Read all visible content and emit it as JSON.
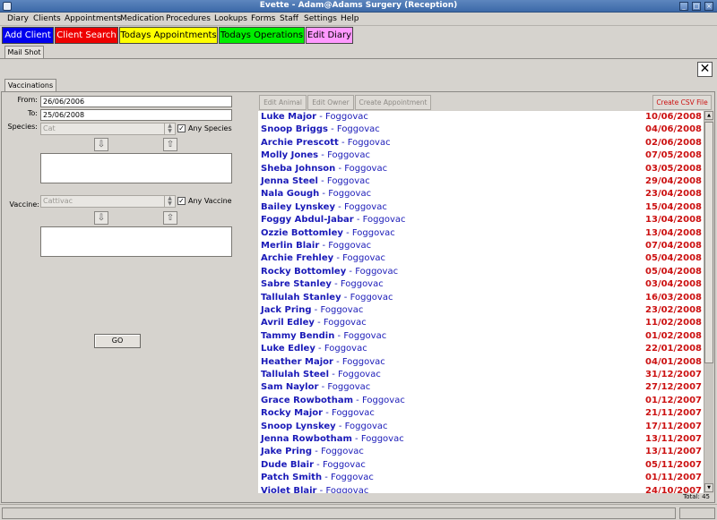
{
  "window": {
    "title": "Evette - Adam@Adams Surgery (Reception)"
  },
  "menu": [
    "Diary",
    "Clients",
    "Appointments",
    "Medication",
    "Procedures",
    "Lookups",
    "Forms",
    "Staff",
    "Settings",
    "Help"
  ],
  "quick_buttons": [
    {
      "label": "Add Client",
      "bg": "#0000ee",
      "fg": "#ffffff"
    },
    {
      "label": "Client Search",
      "bg": "#ee0000",
      "fg": "#ffffff"
    },
    {
      "label": "Todays Appointments",
      "bg": "#ffff00",
      "fg": "#000000"
    },
    {
      "label": "Todays Operations",
      "bg": "#00ee00",
      "fg": "#000000"
    },
    {
      "label": "Edit Diary",
      "bg": "#ff99ff",
      "fg": "#000000"
    }
  ],
  "tabs": {
    "mail_shot": "Mail Shot",
    "vaccinations": "Vaccinations"
  },
  "close_glyph": "✕",
  "form": {
    "from_label": "From:",
    "from_value": "26/06/2006",
    "to_label": "To:",
    "to_value": "25/06/2008",
    "species_label": "Species:",
    "species_value": "Cat",
    "any_species_label": "Any Species",
    "vaccine_label": "Vaccine:",
    "vaccine_value": "Cattivac",
    "any_vaccine_label": "Any Vaccine",
    "checkmark": "✓",
    "go_label": "GO",
    "down_arrow": "⇩",
    "up_arrow": "⇧",
    "spin_up": "▲",
    "spin_down": "▼"
  },
  "toolbar": {
    "edit_animal": "Edit Animal",
    "edit_owner": "Edit Owner",
    "create_appointment": "Create Appointment",
    "create_csv": "Create CSV File"
  },
  "results": {
    "separator": " - ",
    "rows": [
      {
        "name": "Luke Major",
        "vaccine": "Foggovac",
        "date": "10/06/2008"
      },
      {
        "name": "Snoop Briggs",
        "vaccine": "Foggovac",
        "date": "04/06/2008"
      },
      {
        "name": "Archie Prescott",
        "vaccine": "Foggovac",
        "date": "02/06/2008"
      },
      {
        "name": "Molly Jones",
        "vaccine": "Foggovac",
        "date": "07/05/2008"
      },
      {
        "name": "Sheba Johnson",
        "vaccine": "Foggovac",
        "date": "03/05/2008"
      },
      {
        "name": "Jenna Steel",
        "vaccine": "Foggovac",
        "date": "29/04/2008"
      },
      {
        "name": "Nala Gough",
        "vaccine": "Foggovac",
        "date": "23/04/2008"
      },
      {
        "name": "Bailey Lynskey",
        "vaccine": "Foggovac",
        "date": "15/04/2008"
      },
      {
        "name": "Foggy Abdul-Jabar",
        "vaccine": "Foggovac",
        "date": "13/04/2008"
      },
      {
        "name": "Ozzie Bottomley",
        "vaccine": "Foggovac",
        "date": "13/04/2008"
      },
      {
        "name": "Merlin Blair",
        "vaccine": "Foggovac",
        "date": "07/04/2008"
      },
      {
        "name": "Archie Frehley",
        "vaccine": "Foggovac",
        "date": "05/04/2008"
      },
      {
        "name": "Rocky Bottomley",
        "vaccine": "Foggovac",
        "date": "05/04/2008"
      },
      {
        "name": "Sabre Stanley",
        "vaccine": "Foggovac",
        "date": "03/04/2008"
      },
      {
        "name": "Tallulah Stanley",
        "vaccine": "Foggovac",
        "date": "16/03/2008"
      },
      {
        "name": "Jack Pring",
        "vaccine": "Foggovac",
        "date": "23/02/2008"
      },
      {
        "name": "Avril Edley",
        "vaccine": "Foggovac",
        "date": "11/02/2008"
      },
      {
        "name": "Tammy Bendin",
        "vaccine": "Foggovac",
        "date": "01/02/2008"
      },
      {
        "name": "Luke Edley",
        "vaccine": "Foggovac",
        "date": "22/01/2008"
      },
      {
        "name": "Heather Major",
        "vaccine": "Foggovac",
        "date": "04/01/2008"
      },
      {
        "name": "Tallulah Steel",
        "vaccine": "Foggovac",
        "date": "31/12/2007"
      },
      {
        "name": "Sam Naylor",
        "vaccine": "Foggovac",
        "date": "27/12/2007"
      },
      {
        "name": "Grace Rowbotham",
        "vaccine": "Foggovac",
        "date": "01/12/2007"
      },
      {
        "name": "Rocky Major",
        "vaccine": "Foggovac",
        "date": "21/11/2007"
      },
      {
        "name": "Snoop Lynskey",
        "vaccine": "Foggovac",
        "date": "17/11/2007"
      },
      {
        "name": "Jenna Rowbotham",
        "vaccine": "Foggovac",
        "date": "13/11/2007"
      },
      {
        "name": "Jake Pring",
        "vaccine": "Foggovac",
        "date": "13/11/2007"
      },
      {
        "name": "Dude Blair",
        "vaccine": "Foggovac",
        "date": "05/11/2007"
      },
      {
        "name": "Patch Smith",
        "vaccine": "Foggovac",
        "date": "01/11/2007"
      },
      {
        "name": "Violet Blair",
        "vaccine": "Foggovac",
        "date": "24/10/2007"
      }
    ]
  },
  "total_text": "Total: 45"
}
